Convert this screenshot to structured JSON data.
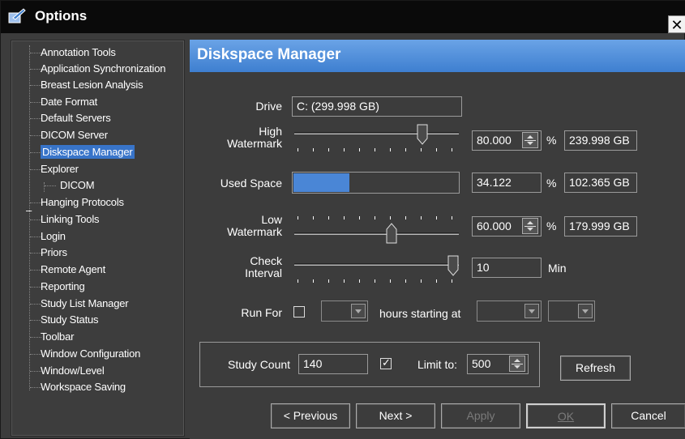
{
  "window": {
    "title": "Options",
    "close_label": "✕"
  },
  "sidebar": {
    "items": [
      {
        "label": "Annotation Tools"
      },
      {
        "label": "Application Synchronization"
      },
      {
        "label": "Breast Lesion Analysis"
      },
      {
        "label": "Date Format"
      },
      {
        "label": "Default Servers"
      },
      {
        "label": "DICOM Server"
      },
      {
        "label": "Diskspace Manager",
        "selected": true
      },
      {
        "label": "Explorer",
        "expanded": true
      },
      {
        "label": "DICOM"
      },
      {
        "label": "Hanging Protocols"
      },
      {
        "label": "Linking Tools"
      },
      {
        "label": "Login"
      },
      {
        "label": "Priors"
      },
      {
        "label": "Remote Agent"
      },
      {
        "label": "Reporting"
      },
      {
        "label": "Study List Manager"
      },
      {
        "label": "Study Status"
      },
      {
        "label": "Toolbar"
      },
      {
        "label": "Window Configuration"
      },
      {
        "label": "Window/Level"
      },
      {
        "label": "Workspace Saving"
      }
    ],
    "expand_glyph": "–"
  },
  "panel": {
    "title": "Diskspace Manager",
    "drive": {
      "label": "Drive",
      "value": "C: (299.998 GB)"
    },
    "high_watermark": {
      "label_line1": "High",
      "label_line2": "Watermark",
      "value": "80.000",
      "percent_sign": "%",
      "size": "239.998 GB",
      "level": 0.8
    },
    "used_space": {
      "label": "Used Space",
      "value": "34.122",
      "percent_sign": "%",
      "size": "102.365 GB",
      "level": 0.34122
    },
    "low_watermark": {
      "label_line1": "Low",
      "label_line2": "Watermark",
      "value": "60.000",
      "percent_sign": "%",
      "size": "179.999 GB",
      "level": 0.6
    },
    "check_interval": {
      "label_line1": "Check",
      "label_line2": "Interval",
      "value": "10",
      "unit": "Min"
    },
    "run_for": {
      "label": "Run For",
      "checked": false,
      "hours_value": "",
      "starting_label": "hours starting at",
      "start_value": "",
      "start_value2": ""
    },
    "study_count": {
      "label": "Study Count",
      "value": "140",
      "limit_checked": true,
      "limit_label": "Limit to:",
      "limit_value": "500"
    },
    "refresh_label": "Refresh"
  },
  "buttons": {
    "previous": "< Previous",
    "next": "Next >",
    "apply": "Apply",
    "ok": "OK",
    "cancel": "Cancel"
  },
  "colors": {
    "accent": "#3e7fd0",
    "selection": "#3874c9",
    "bar_fill": "#4a86d6",
    "background": "#3c3c3c"
  }
}
